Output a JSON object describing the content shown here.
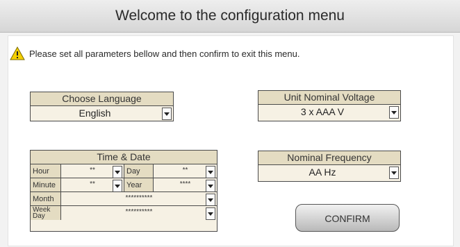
{
  "header": {
    "title": "Welcome to the configuration menu"
  },
  "notice": {
    "icon": "warning-icon",
    "text": "Please set all parameters bellow and then confirm to exit this menu."
  },
  "language": {
    "title": "Choose Language",
    "value": "English"
  },
  "voltage": {
    "title": "Unit Nominal Voltage",
    "value": "3 x AAA V"
  },
  "frequency": {
    "title": "Nominal Frequency",
    "value": "AA Hz"
  },
  "time_date": {
    "title": "Time & Date",
    "hour_label": "Hour",
    "hour_value": "**",
    "day_label": "Day",
    "day_value": "**",
    "minute_label": "Minute",
    "minute_value": "**",
    "year_label": "Year",
    "year_value": "****",
    "month_label": "Month",
    "month_value": "**********",
    "weekday_label_line1": "Week",
    "weekday_label_line2": "Day",
    "weekday_value": "**********"
  },
  "confirm": {
    "label": "CONFIRM"
  },
  "colors": {
    "accent_box": "#e4dcc2",
    "box_fill": "#f6f1e4",
    "warning": "#f5d000"
  }
}
